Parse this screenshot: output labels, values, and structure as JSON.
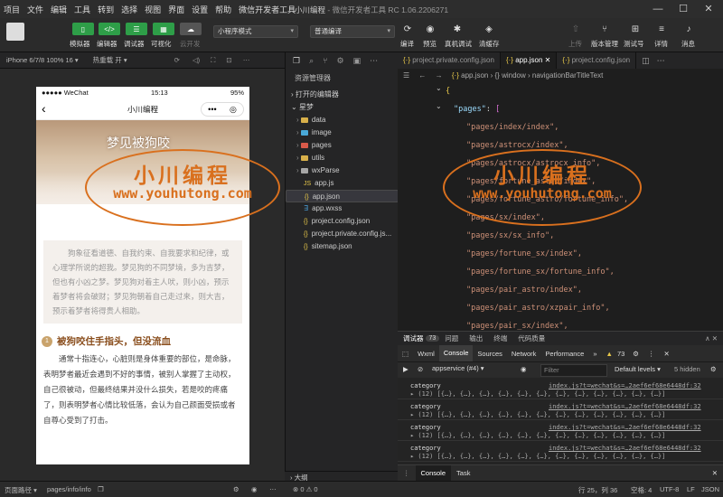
{
  "window": {
    "title_app": "小川编程",
    "title_rest": " - 微信开发者工具 RC 1.06.2206271"
  },
  "menu": [
    "项目",
    "文件",
    "编辑",
    "工具",
    "转到",
    "选择",
    "视图",
    "界面",
    "设置",
    "帮助",
    "微信开发者工具"
  ],
  "toolbar": {
    "simulator": "模拟器",
    "editor": "编辑器",
    "debugger": "调试器",
    "visual": "可视化",
    "cloud": "云开发",
    "mode": "小程序模式",
    "compile_mode": "普通编译",
    "compile": "编译",
    "preview": "预览",
    "real_debug": "真机调试",
    "clear_cache": "清缓存",
    "upload": "上传",
    "version": "版本管理",
    "test": "测试号",
    "details": "详情",
    "messages": "消息"
  },
  "simulator": {
    "device": "iPhone 6/7/8 100% 16 ▾",
    "hotreload": "热重载 开 ▾",
    "status_left": "●●●●● WeChat",
    "status_time": "15:13",
    "status_right": "95%",
    "nav_title": "小川编程",
    "hero_title": "梦见被狗咬",
    "summary": "狗象征看道德、自我约束、自我要求和纪律，或心理学所说的超我。梦见狗的不同梦境，多为吉梦，但也有小凶之梦。梦见狗对着主人吠，则小凶，预示着梦者将会破财；梦见狗朝着自己走过来，则大吉，预示着梦者将得贵人相助。",
    "section_num": "1",
    "section_title": "被狗咬住手指头，但没流血",
    "body": "通常十指连心，心脏则是身体重要的部位，是命脉，表明梦者最近会遇到不好的事情，被别人掌握了主动权，自己很被动，但最终结果并没什么损失，若是咬的疼痛了，则表明梦者心情比较低落，会认为自己颜面受损或者自尊心受到了打击。"
  },
  "watermark": {
    "cn": "小川编程",
    "en": "www.youhutong.com"
  },
  "explorer": {
    "title": "资源管理器",
    "open_editors": "打开的编辑器",
    "project": "星梦",
    "items": [
      {
        "name": "data",
        "type": "folder"
      },
      {
        "name": "image",
        "type": "folder"
      },
      {
        "name": "pages",
        "type": "folder"
      },
      {
        "name": "utils",
        "type": "folder"
      },
      {
        "name": "wxParse",
        "type": "folder"
      },
      {
        "name": "app.js",
        "type": "js"
      },
      {
        "name": "app.json",
        "type": "json"
      },
      {
        "name": "app.wxss",
        "type": "wxss"
      },
      {
        "name": "project.config.json",
        "type": "json"
      },
      {
        "name": "project.private.config.js...",
        "type": "json"
      },
      {
        "name": "sitemap.json",
        "type": "json"
      }
    ],
    "outline": "大纲"
  },
  "editor": {
    "tabs": [
      "project.private.config.json",
      "app.json",
      "project.config.json"
    ],
    "breadcrumb": [
      "app.json",
      "window",
      "navigationBarTitleText"
    ],
    "pages_key": "\"pages\"",
    "pages": [
      "\"pages/index/index\",",
      "\"pages/astrocx/index\",",
      "\"pages/astrocx/astrocx_info\",",
      "\"pages/fortune_astro/index\",",
      "\"pages/fortune_astro/fortune_info\",",
      "\"pages/sx/index\",",
      "\"pages/sx/sx_info\",",
      "\"pages/fortune_sx/index\",",
      "\"pages/fortune_sx/fortune_info\",",
      "\"pages/pair_astro/index\",",
      "\"pages/pair_astro/xzpair_info\",",
      "\"pages/pair_sx/index\","
    ]
  },
  "devtools": {
    "tabs": [
      "调试器",
      "问题",
      "输出",
      "终端",
      "代码质量"
    ],
    "badge": "73",
    "panels": [
      "Wxml",
      "Console",
      "Sources",
      "Network",
      "Performance"
    ],
    "warn_count": "73",
    "context": "appservice (#4)",
    "filter_placeholder": "Filter",
    "levels": "Default levels ▾",
    "hidden": "5 hidden",
    "logs": [
      {
        "label": "category",
        "link": "index.js?t=wechat&s=…2aef6ef68e6448df:32",
        "array": "▸ (12) [{…}, {…}, {…}, {…}, {…}, {…}, {…}, {…}, {…}, {…}, {…}, {…}]"
      },
      {
        "label": "category",
        "link": "index.js?t=wechat&s=…2aef6ef68e6448df:32",
        "array": "▸ (12) [{…}, {…}, {…}, {…}, {…}, {…}, {…}, {…}, {…}, {…}, {…}, {…}]"
      },
      {
        "label": "category",
        "link": "index.js?t=wechat&s=…2aef6ef68e6448df:32",
        "array": "▸ (12) [{…}, {…}, {…}, {…}, {…}, {…}, {…}, {…}, {…}, {…}, {…}, {…}]"
      },
      {
        "label": "category",
        "link": "index.js?t=wechat&s=…2aef6ef68e6448df:32",
        "array": "▸ (12) [{…}, {…}, {…}, {…}, {…}, {…}, {…}, {…}, {…}, {…}, {…}, {…}]"
      }
    ],
    "bottom_tabs": [
      "Console",
      "Task"
    ]
  },
  "status": {
    "path_label": "页面路径 ▾",
    "path": "pages/info/info",
    "errors": "⊗ 0 ⚠ 0",
    "position": "行 25，列 36",
    "spaces": "空格: 4",
    "encoding": "UTF-8",
    "eol": "LF",
    "lang": "JSON"
  },
  "colors": {
    "accent_green": "#2e9e48",
    "watermark": "#d9701e",
    "section_title": "#8a4e1d"
  }
}
